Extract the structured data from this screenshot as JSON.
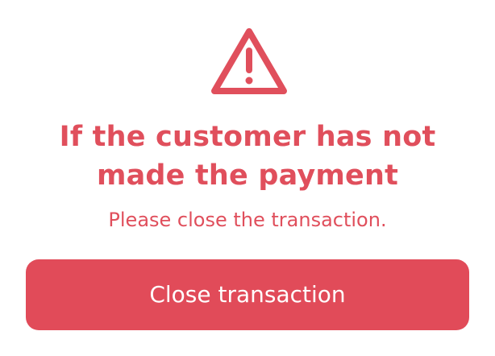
{
  "theme": {
    "accent": "#e04f5c",
    "button_bg": "#e14b59",
    "button_text": "#ffffff",
    "background": "#ffffff"
  },
  "dialog": {
    "icon": "warning-triangle-icon",
    "title": "If the customer has not made the payment",
    "subtitle": "Please close the transaction.",
    "close_button_label": "Close transaction"
  }
}
